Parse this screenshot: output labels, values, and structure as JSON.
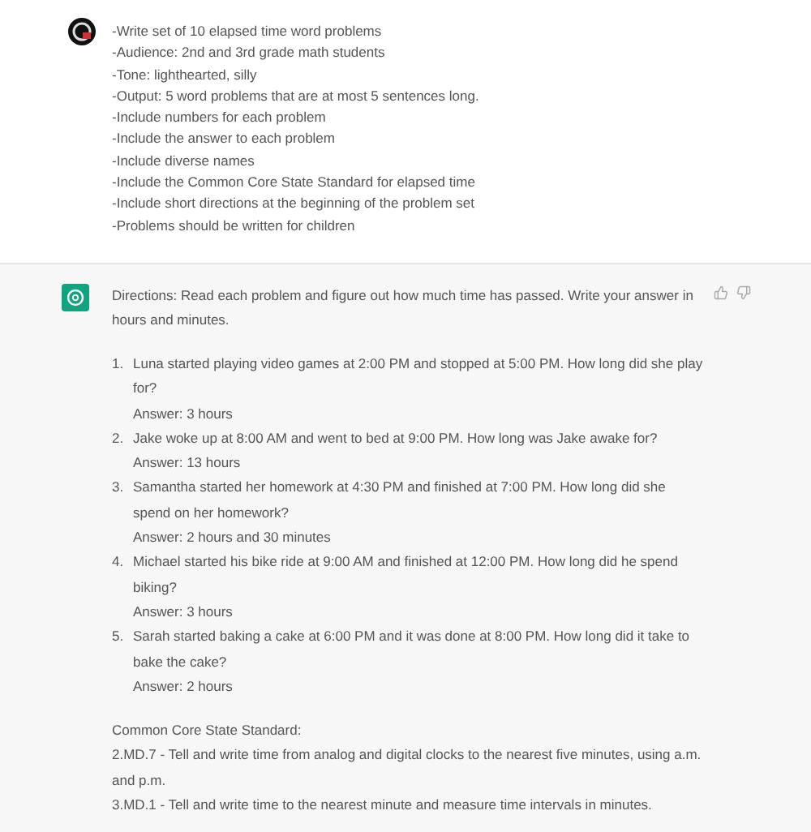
{
  "user_message": {
    "lines": [
      "-Write set of 10 elapsed time word problems",
      "-Audience: 2nd and 3rd grade math students",
      "-Tone: lighthearted, silly",
      "-Output: 5 word problems that are at most 5 sentences long.",
      "-Include numbers for each problem",
      "-Include the answer to each problem",
      "-Include diverse names",
      "-Include the Common Core State Standard for elapsed time",
      "-Include short directions at the beginning of the problem set",
      "-Problems should be written for children"
    ]
  },
  "assistant_message": {
    "directions": "Directions: Read each problem and figure out how much time has passed. Write your answer in hours and minutes.",
    "problems": [
      {
        "number": "1.",
        "question": "Luna started playing video games at 2:00 PM and stopped at 5:00 PM. How long did she play for?",
        "answer": "Answer: 3 hours"
      },
      {
        "number": "2.",
        "question": "Jake woke up at 8:00 AM and went to bed at 9:00 PM. How long was Jake awake for?",
        "answer": "Answer: 13 hours"
      },
      {
        "number": "3.",
        "question": "Samantha started her homework at 4:30 PM and finished at 7:00 PM. How long did she spend on her homework?",
        "answer": "Answer: 2 hours and 30 minutes"
      },
      {
        "number": "4.",
        "question": "Michael started his bike ride at 9:00 AM and finished at 12:00 PM. How long did he spend biking?",
        "answer": "Answer: 3 hours"
      },
      {
        "number": "5.",
        "question": "Sarah started baking a cake at 6:00 PM and it was done at 8:00 PM. How long did it take to bake the cake?",
        "answer": "Answer: 2 hours"
      }
    ],
    "standard_heading": "Common Core State Standard:",
    "standards": [
      "2.MD.7 - Tell and write time from analog and digital clocks to the nearest five minutes, using a.m. and p.m.",
      "3.MD.1 - Tell and write time to the nearest minute and measure time intervals in minutes."
    ]
  }
}
